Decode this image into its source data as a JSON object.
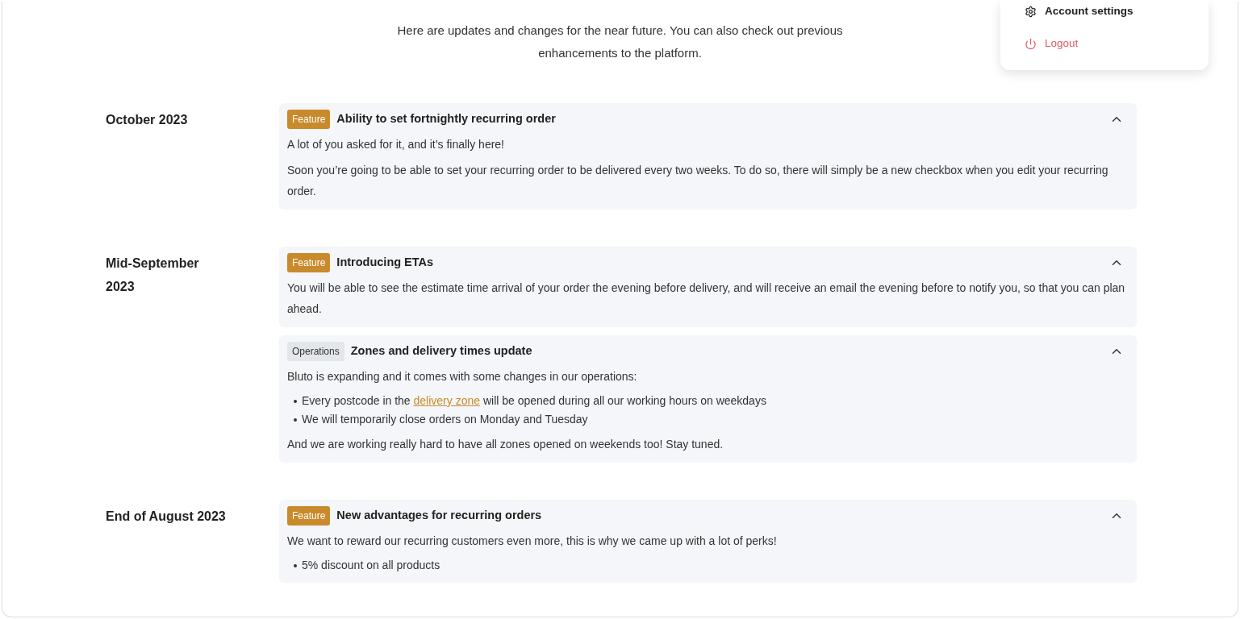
{
  "intro": "Here are updates and changes for the near future. You can also check out previous enhancements to the platform.",
  "menu": [
    {
      "kind": "settings",
      "label": "Account settings"
    },
    {
      "kind": "logout",
      "label": "Logout"
    }
  ],
  "timeline": [
    {
      "date": "October 2023",
      "entries": [
        {
          "tag": "Feature",
          "kind": "feature",
          "title": "Ability to set fortnightly recurring order",
          "expanded": true,
          "body": [
            {
              "kind": "p",
              "text": "A lot of you asked for it, and it’s finally here!"
            },
            {
              "kind": "p",
              "text": "Soon you’re going to be able to set your recurring order to be delivered every two weeks. To do so, there will simply be a new checkbox when you edit your recurring order."
            }
          ]
        }
      ]
    },
    {
      "date": "Mid-September 2023",
      "entries": [
        {
          "tag": "Feature",
          "kind": "feature",
          "title": "Introducing ETAs",
          "expanded": true,
          "body": [
            {
              "kind": "p",
              "text": "You will be able to see the estimate time arrival of your order the evening before delivery, and will receive an email the evening before to notify you, so that you can plan ahead."
            }
          ]
        },
        {
          "tag": "Operations",
          "kind": "operations",
          "title": "Zones and delivery times update",
          "expanded": true,
          "body": [
            {
              "kind": "p",
              "text": "Bluto is expanding and it comes with some changes in our operations:"
            },
            {
              "kind": "list",
              "items": [
                {
                  "before": "Every postcode in the",
                  "link": "delivery zone",
                  "after": "will be opened during all our working hours on weekdays"
                },
                {
                  "before": "We will temporarily close orders on Monday and Tuesday"
                }
              ]
            },
            {
              "kind": "p",
              "text": "And we are working really hard to have all zones opened on weekends too! Stay tuned."
            }
          ]
        }
      ]
    },
    {
      "date": "End of August 2023",
      "entries": [
        {
          "tag": "Feature",
          "kind": "feature",
          "title": "New advantages for recurring orders",
          "expanded": true,
          "body": [
            {
              "kind": "p",
              "text": "We want to reward our recurring customers even more, this is why we came up with a lot of perks!"
            },
            {
              "kind": "list",
              "items": [
                {
                  "before": "5% discount on all products"
                }
              ]
            }
          ]
        }
      ]
    }
  ]
}
